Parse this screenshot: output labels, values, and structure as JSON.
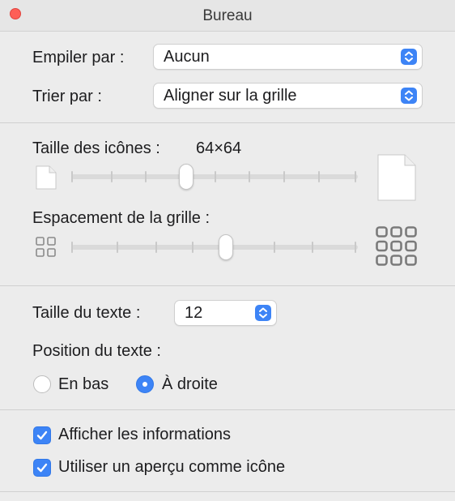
{
  "window": {
    "title": "Bureau"
  },
  "stack_by": {
    "label": "Empiler par :",
    "value": "Aucun"
  },
  "sort_by": {
    "label": "Trier par :",
    "value": "Aligner sur la grille"
  },
  "icon_size": {
    "label": "Taille des icônes :",
    "value": "64×64",
    "level": 0.4
  },
  "grid_spacing": {
    "label": "Espacement de la grille :",
    "level": 0.54
  },
  "text_size": {
    "label": "Taille du texte :",
    "value": "12"
  },
  "text_position": {
    "label": "Position du texte :",
    "options": [
      {
        "label": "En bas",
        "selected": false
      },
      {
        "label": "À droite",
        "selected": true
      }
    ]
  },
  "show_info": {
    "label": "Afficher les informations",
    "checked": true
  },
  "preview_icon": {
    "label": "Utiliser un aperçu comme icône",
    "checked": true
  },
  "accent_color": "#3d84f6"
}
